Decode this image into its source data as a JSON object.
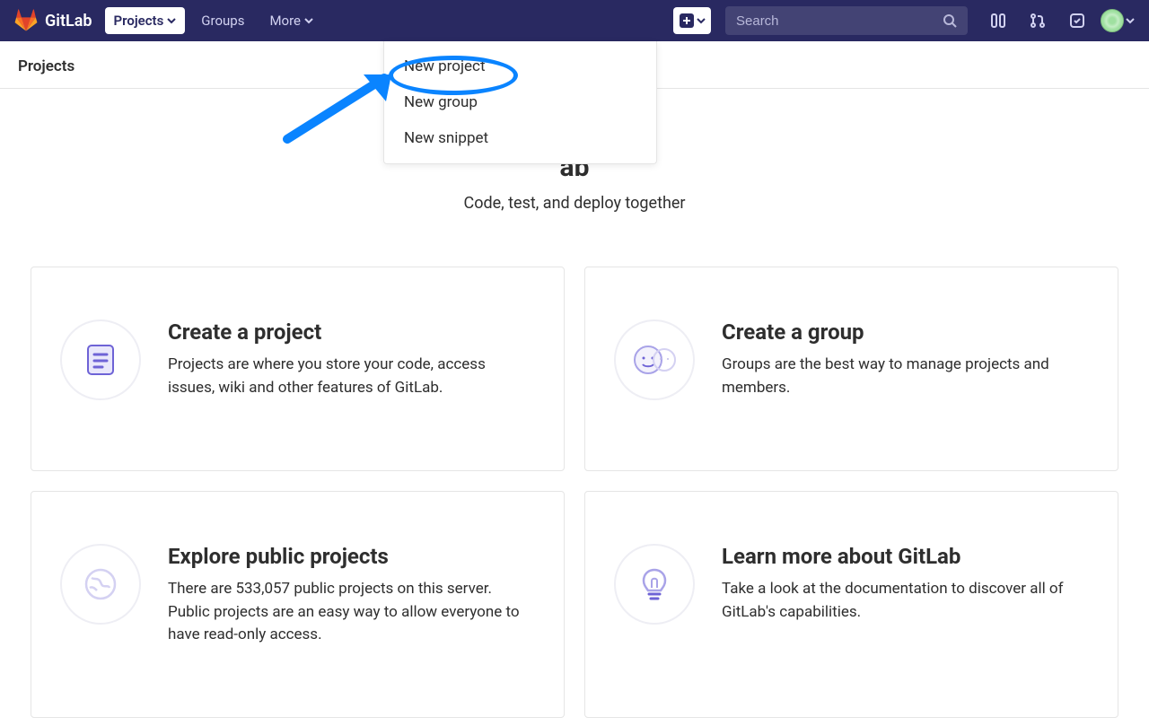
{
  "brand": "GitLab",
  "nav": {
    "projects": "Projects",
    "groups": "Groups",
    "more": "More"
  },
  "search": {
    "placeholder": "Search"
  },
  "subheader": "Projects",
  "plus_dropdown": {
    "items": [
      "New project",
      "New group",
      "New snippet"
    ]
  },
  "welcome": {
    "title_visible_suffix": "ab",
    "subtitle": "Code, test, and deploy together"
  },
  "cards": [
    {
      "title": "Create a project",
      "desc": "Projects are where you store your code, access issues, wiki and other features of GitLab."
    },
    {
      "title": "Create a group",
      "desc": "Groups are the best way to manage projects and members."
    },
    {
      "title": "Explore public projects",
      "desc": "There are 533,057 public projects on this server. Public projects are an easy way to allow everyone to have read-only access."
    },
    {
      "title": "Learn more about GitLab",
      "desc": "Take a look at the documentation to discover all of GitLab's capabilities."
    }
  ]
}
